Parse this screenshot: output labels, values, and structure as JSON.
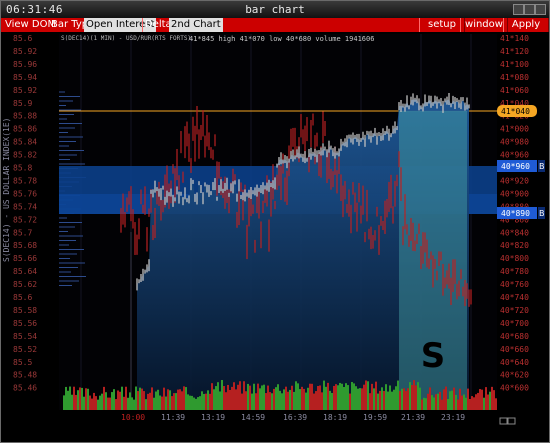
{
  "titlebar": {
    "time": "06:31:46",
    "title": "bar chart"
  },
  "menu": {
    "view_dom": "View DOM",
    "bar_type": "Bar Type",
    "open_interest": "Open Interest",
    "delta": "Delta",
    "second_chart": "2nd Chart",
    "setup": "setup",
    "window": "window",
    "apply": "Apply"
  },
  "chart": {
    "instrument": "S(DEC14)(1 MIN) - USD/RUR(RTS FORTS)",
    "stats": "41*845 high 41*070 low 40*680 volume 1941606",
    "left_axis_label": "S(DEC14) - US DOLLAR INDEX(1E)",
    "left_axis": [
      "85.6",
      "85.92",
      "85.96",
      "85.94",
      "85.92",
      "85.9",
      "85.88",
      "85.86",
      "85.84",
      "85.82",
      "85.8",
      "85.78",
      "85.76",
      "85.74",
      "85.72",
      "85.7",
      "85.68",
      "85.66",
      "85.64",
      "85.62",
      "85.6",
      "85.58",
      "85.56",
      "85.54",
      "85.52",
      "85.5",
      "85.48",
      "85.46"
    ],
    "right_axis": [
      "41*140",
      "41*120",
      "41*100",
      "41*080",
      "41*060",
      "41*040",
      "41*020",
      "41*000",
      "40*980",
      "40*960",
      "40*940",
      "40*920",
      "40*900",
      "40*880",
      "40*860",
      "40*840",
      "40*820",
      "40*800",
      "40*780",
      "40*760",
      "40*740",
      "40*720",
      "40*700",
      "40*680",
      "40*660",
      "40*640",
      "40*620",
      "40*600"
    ],
    "time_labels": [
      "11:39",
      "13:19",
      "14:59",
      "16:39",
      "18:19",
      "19:59",
      "21:39",
      "23:19"
    ],
    "session_start_label": "10:00",
    "price_marker": "41*040",
    "level_markers": [
      "40*960",
      "40*890"
    ],
    "level_tags": [
      "B",
      "B"
    ],
    "zone_letter": "S",
    "colors": {
      "menu_bg": "#cc0000",
      "axis_left": "#9a3838",
      "axis_right": "#bb3030",
      "usd_line": "#c0c0c0",
      "index_bars": "#bb2222",
      "band": "#0b3f8a",
      "zone": "#47a4a8",
      "marker_orange": "#f5a623",
      "marker_blue": "#1f5bd6"
    }
  }
}
